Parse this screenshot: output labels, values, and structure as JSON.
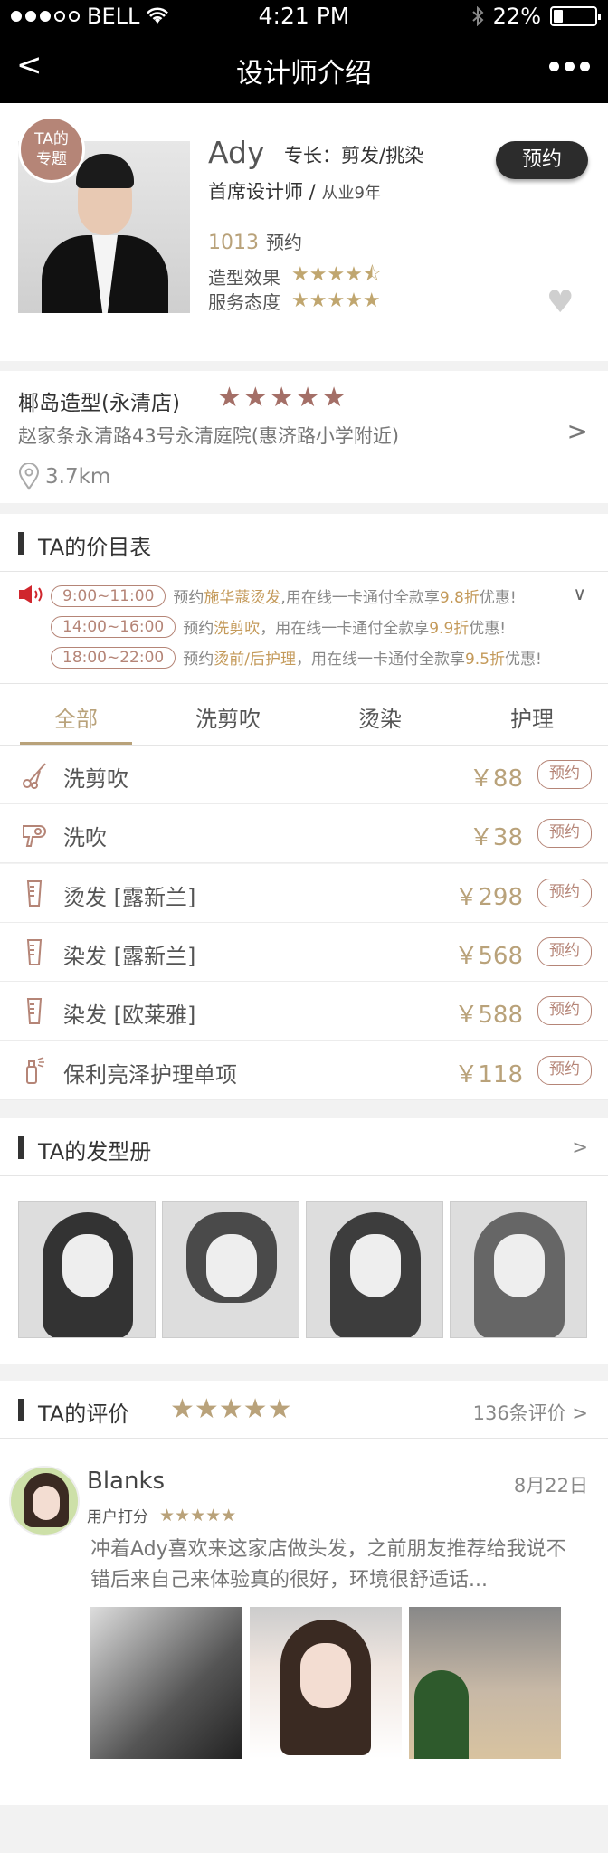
{
  "status_bar": {
    "carrier": "BELL",
    "time": "4:21 PM",
    "battery": "22%",
    "battery_level": 0.22
  },
  "nav": {
    "back": "<",
    "title": "设计师介绍"
  },
  "profile": {
    "badge_line1": "TA的",
    "badge_line2": "专题",
    "name": "Ady",
    "specialty": "专长：剪发/挑染",
    "title": "首席设计师 /",
    "experience": "从业9年",
    "booking_count": "1013",
    "booking_label": "预约",
    "rating1_label": "造型效果",
    "rating1_stars": "★★★★⯪",
    "rating2_label": "服务态度",
    "rating2_stars": "★★★★★",
    "book_button": "预约"
  },
  "salon": {
    "name": "椰岛造型(永清店)",
    "stars": "★★★★★",
    "address": "赵家条永清路43号永清庭院(惠济路小学附近)",
    "arrow": ">",
    "distance": "3.7km"
  },
  "price_section": {
    "title": "TA的价目表"
  },
  "promos": [
    {
      "time": "9:00~11:00",
      "pre": "预约",
      "highlight": "施华蔻烫发",
      "mid": ",用在线一卡通付全款享",
      "discount": "9.8折",
      "post": "优惠!"
    },
    {
      "time": "14:00~16:00",
      "pre": "预约",
      "highlight": "洗剪吹",
      "mid": "，用在线一卡通付全款享",
      "discount": "9.9折",
      "post": "优惠!"
    },
    {
      "time": "18:00~22:00",
      "pre": "预约",
      "highlight": "烫前/后护理",
      "mid": "，用在线一卡通付全款享",
      "discount": "9.5折",
      "post": "优惠!"
    }
  ],
  "tabs": [
    "全部",
    "洗剪吹",
    "烫染",
    "护理"
  ],
  "services": [
    {
      "name": "洗剪吹",
      "price": "￥88",
      "book": "预约"
    },
    {
      "name": "洗吹",
      "price": "￥38",
      "book": "预约"
    },
    {
      "name": "烫发 [露新兰]",
      "price": "￥298",
      "book": "预约"
    },
    {
      "name": "染发 [露新兰]",
      "price": "￥568",
      "book": "预约"
    },
    {
      "name": "染发 [欧莱雅]",
      "price": "￥588",
      "book": "预约"
    },
    {
      "name": "保利亮泽护理单项",
      "price": "￥118",
      "book": "预约"
    }
  ],
  "gallery_section": {
    "title": "TA的发型册",
    "arrow": ">"
  },
  "review_section": {
    "title": "TA的评价",
    "stars": "★★★★★",
    "count": "136条评价 >"
  },
  "review": {
    "user": "Blanks",
    "date": "8月22日",
    "score_label": "用户打分",
    "score_stars": "★★★★★",
    "text": "冲着Ady喜欢来这家店做头发，之前朋友推荐给我说不错后来自己来体验真的很好，环境很舒适话..."
  },
  "colors": {
    "gold": "#b9a27a",
    "rose": "#b58577",
    "alert_red": "#d0262d"
  }
}
